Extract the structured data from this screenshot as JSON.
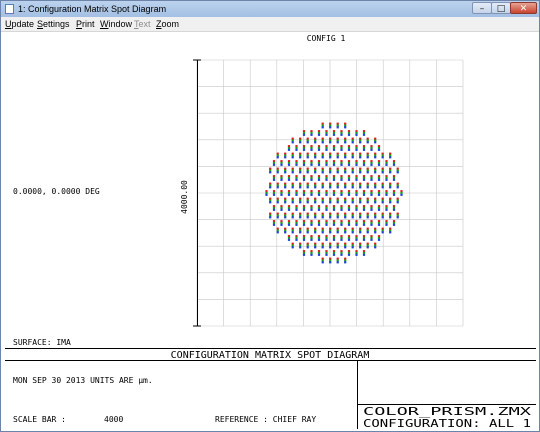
{
  "window": {
    "title": "1: Configuration Matrix Spot Diagram",
    "buttons": {
      "minimize": "–",
      "maximize": "□",
      "close": "✕"
    }
  },
  "menu": [
    {
      "label": "Update",
      "accel": "U",
      "rest": "pdate",
      "enabled": true
    },
    {
      "label": "Settings",
      "accel": "S",
      "rest": "ettings",
      "enabled": true
    },
    {
      "label": "Print",
      "accel": "P",
      "rest": "rint",
      "enabled": true
    },
    {
      "label": "Window",
      "accel": "W",
      "rest": "indow",
      "enabled": true
    },
    {
      "label": "Text",
      "accel": "T",
      "rest": "ext",
      "enabled": false
    },
    {
      "label": "Zoom",
      "accel": "Z",
      "rest": "oom",
      "enabled": true
    }
  ],
  "plot": {
    "config_label": "CONFIG 1",
    "field_label": "0.0000, 0.0000 DEG",
    "scale_label": "4000.00",
    "surface_label": "SURFACE: IMA"
  },
  "footer": {
    "title": "CONFIGURATION MATRIX SPOT DIAGRAM",
    "date_units": "MON SEP 30 2013  UNITS ARE µm.",
    "scale_bar_label": "SCALE BAR  :",
    "scale_bar_value": "4000",
    "reference": "REFERENCE  : CHIEF RAY",
    "filename": "COLOR_PRISM.ZMX",
    "configuration": "CONFIGURATION: ALL 1"
  },
  "colors": {
    "wave1": "#1f3fe0",
    "wave2": "#17a317",
    "wave3": "#e01818",
    "grid": "#c8c8c8",
    "titlebar": "#b4cbea"
  }
}
